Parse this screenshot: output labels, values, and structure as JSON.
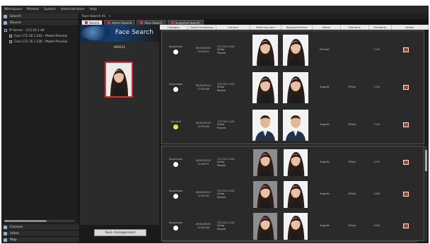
{
  "menu": [
    "Workspace",
    "Module",
    "System",
    "Administration",
    "Help"
  ],
  "left_panel": {
    "search_header": "Search",
    "device_header": "Device",
    "tree": [
      "IP Server - 172.16.1.46",
      "Cam 172.16.1.241 - Model Preview",
      "Cam 172.16.1.236 - Model Preview"
    ],
    "bottom_sections": [
      "Camera",
      "Video",
      "Map"
    ]
  },
  "top_row": {
    "label": "Face Search 01",
    "close": "×"
  },
  "tabs": [
    {
      "label": "Search",
      "active": true
    },
    {
      "label": "Alarm Search",
      "active": false
    },
    {
      "label": "Face Search",
      "active": false
    },
    {
      "label": "Snapshot Search",
      "active": false
    }
  ],
  "face_panel": {
    "title": "Face Search",
    "photo_label": "WN022",
    "manage_button": "Face management"
  },
  "columns": [
    "Category",
    "Event timestamp",
    "Camera",
    "Matching face",
    "Registered face",
    "Name",
    "Remarks",
    "Similarity",
    "Action"
  ],
  "alarm_results": [
    {
      "category": "Suspicious",
      "marker": "white",
      "timestamp": "09/02/2019\n12:09:41",
      "camera": "172.16.1.241\nVideo\nPeople",
      "name": "Female",
      "remarks": "",
      "similarity": "1.00"
    },
    {
      "category": "Suspicious",
      "marker": "white",
      "timestamp": "09/02/2019\n12:09:48",
      "camera": "172.16.1.241\nVideo\nPeople",
      "name": "Angelik",
      "remarks": "Office",
      "similarity": "1.00"
    },
    {
      "category": "General",
      "marker": "yellow",
      "timestamp": "09/02/2019\n12:09:48",
      "camera": "172.16.1.241\nVideo\nPeople",
      "name": "Angelik",
      "remarks": "Office",
      "similarity": "1.00"
    }
  ],
  "search_results": [
    {
      "category": "Suspicious",
      "marker": "white",
      "timestamp": "09/02/2019\n12:09:31",
      "camera": "172.16.1.241\nVideo\nPeople",
      "name": "Angelik",
      "remarks": "Office",
      "similarity": "0.92"
    },
    {
      "category": "Suspicious",
      "marker": "white",
      "timestamp": "09/02/2019\n12:09:30",
      "camera": "172.16.1.241\nVideo\nPeople",
      "name": "Angelik",
      "remarks": "Office",
      "similarity": "0.86"
    },
    {
      "category": "Suspicious",
      "marker": "white",
      "timestamp": "09/02/2019\n12:09:28",
      "camera": "172.16.1.241\nVideo\nPeople",
      "name": "Angelik",
      "remarks": "Office",
      "similarity": "0.84"
    }
  ],
  "icons": {
    "marker_white": "#ffffff",
    "marker_yellow": "#f2e23a",
    "accent_red": "#d52f2f"
  }
}
